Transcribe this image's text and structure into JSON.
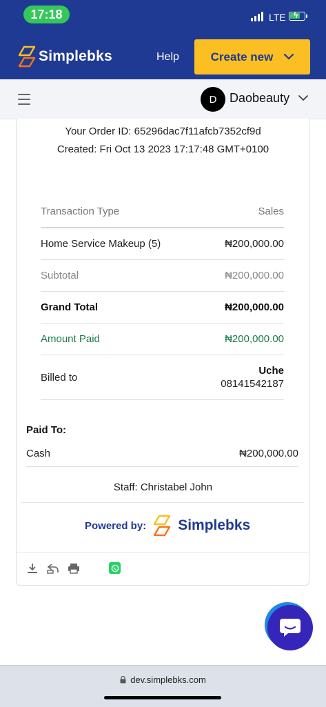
{
  "status_bar": {
    "time": "17:18",
    "network": "LTE",
    "colors": {
      "time_pill": "#34c759",
      "battery": "#34c759"
    }
  },
  "header": {
    "brand": "Simplebks",
    "help_label": "Help",
    "create_label": "Create new",
    "colors": {
      "background": "#1f3a93",
      "create_button": "#fbbf24"
    }
  },
  "subbar": {
    "avatar_letter": "D",
    "account_name": "Daobeauty"
  },
  "receipt": {
    "order_id": "Your Order ID: 65296dac7f11afcb7352cf9d",
    "created": "Created: Fri Oct 13 2023 17:17:48 GMT+0100",
    "table": {
      "header": {
        "left": "Transaction Type",
        "right": "Sales"
      },
      "item": {
        "label": "Home Service Makeup (5)",
        "value": "₦200,000.00"
      },
      "subtotal": {
        "label": "Subtotal",
        "value": "₦200,000.00"
      },
      "grand_total": {
        "label": "Grand Total",
        "value": "₦200,000.00"
      },
      "amount_paid": {
        "label": "Amount Paid",
        "value": "₦200,000.00"
      },
      "billed_to": {
        "label": "Billed to",
        "name": "Uche",
        "phone": "08141542187"
      }
    },
    "paid_to": {
      "title": "Paid To:",
      "method": "Cash",
      "amount": "₦200,000.00"
    },
    "staff": "Staff: Christabel John",
    "powered_by": {
      "label": "Powered by:",
      "brand": "Simplebks"
    },
    "actions": [
      "download-icon",
      "reply-icon",
      "print-icon",
      "whatsapp-icon"
    ]
  },
  "browser": {
    "url": "dev.simplebks.com"
  }
}
